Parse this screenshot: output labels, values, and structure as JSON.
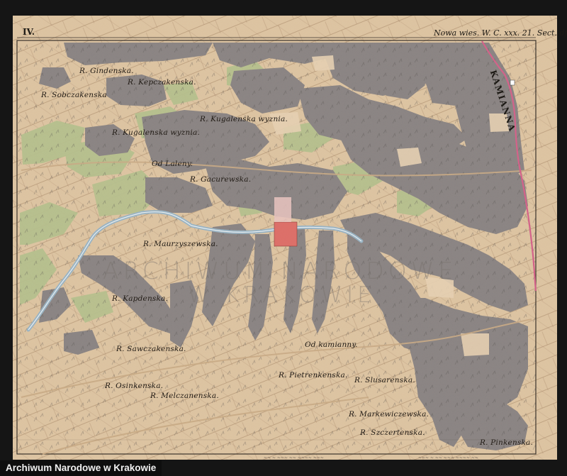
{
  "sheet": {
    "number": "IV.",
    "header": "Nowa wies. W. C. xxx. 21. Sect. df"
  },
  "neighbour_label": "KAMIANNA",
  "place_names": [
    {
      "id": "gindenska",
      "text": "R. Gindenska."
    },
    {
      "id": "kepczakenska",
      "text": "R. Kepczakenska."
    },
    {
      "id": "sobczakenska",
      "text": "R. Sobczakenska"
    },
    {
      "id": "kugalenska-wyznia-1",
      "text": "R. Kugalenska wyznia."
    },
    {
      "id": "kugalenska-wyznia-2",
      "text": "R. Kugalenska wyznia."
    },
    {
      "id": "od-laleny",
      "text": "Od Laleny."
    },
    {
      "id": "gacurewska",
      "text": "R. Gacurewska."
    },
    {
      "id": "maurzyszewska",
      "text": "R. Maurzyszewska."
    },
    {
      "id": "kapdenska",
      "text": "R. Kapdenska."
    },
    {
      "id": "sawczakenska",
      "text": "R. Sawczakenska."
    },
    {
      "id": "od-kamianny",
      "text": "Od kamianny."
    },
    {
      "id": "pietrenkenska",
      "text": "R. Pietrenkenska."
    },
    {
      "id": "slusarenska",
      "text": "R. Slusarenska."
    },
    {
      "id": "osinkenska",
      "text": "R. Osinkenska."
    },
    {
      "id": "melczanenska",
      "text": "R. Melczanenska."
    },
    {
      "id": "markewiczewska",
      "text": "R. Markewiczewska."
    },
    {
      "id": "szczertenska",
      "text": "R. Szczertenska."
    },
    {
      "id": "pinkenska",
      "text": "R. Pinkenska."
    }
  ],
  "watermark": {
    "line1": "ARCHIWUM NARODOWE",
    "line2": "W KRAKOWIE"
  },
  "footer_label": "Archiwum Narodowe w Krakowie",
  "colors": {
    "paper": "#ddc4a2",
    "forest": "#8b8584",
    "meadow": "#b6c08e",
    "stream": "#9ab4c4",
    "border_pink": "#d4628a",
    "building_red": "#dd6f69"
  }
}
